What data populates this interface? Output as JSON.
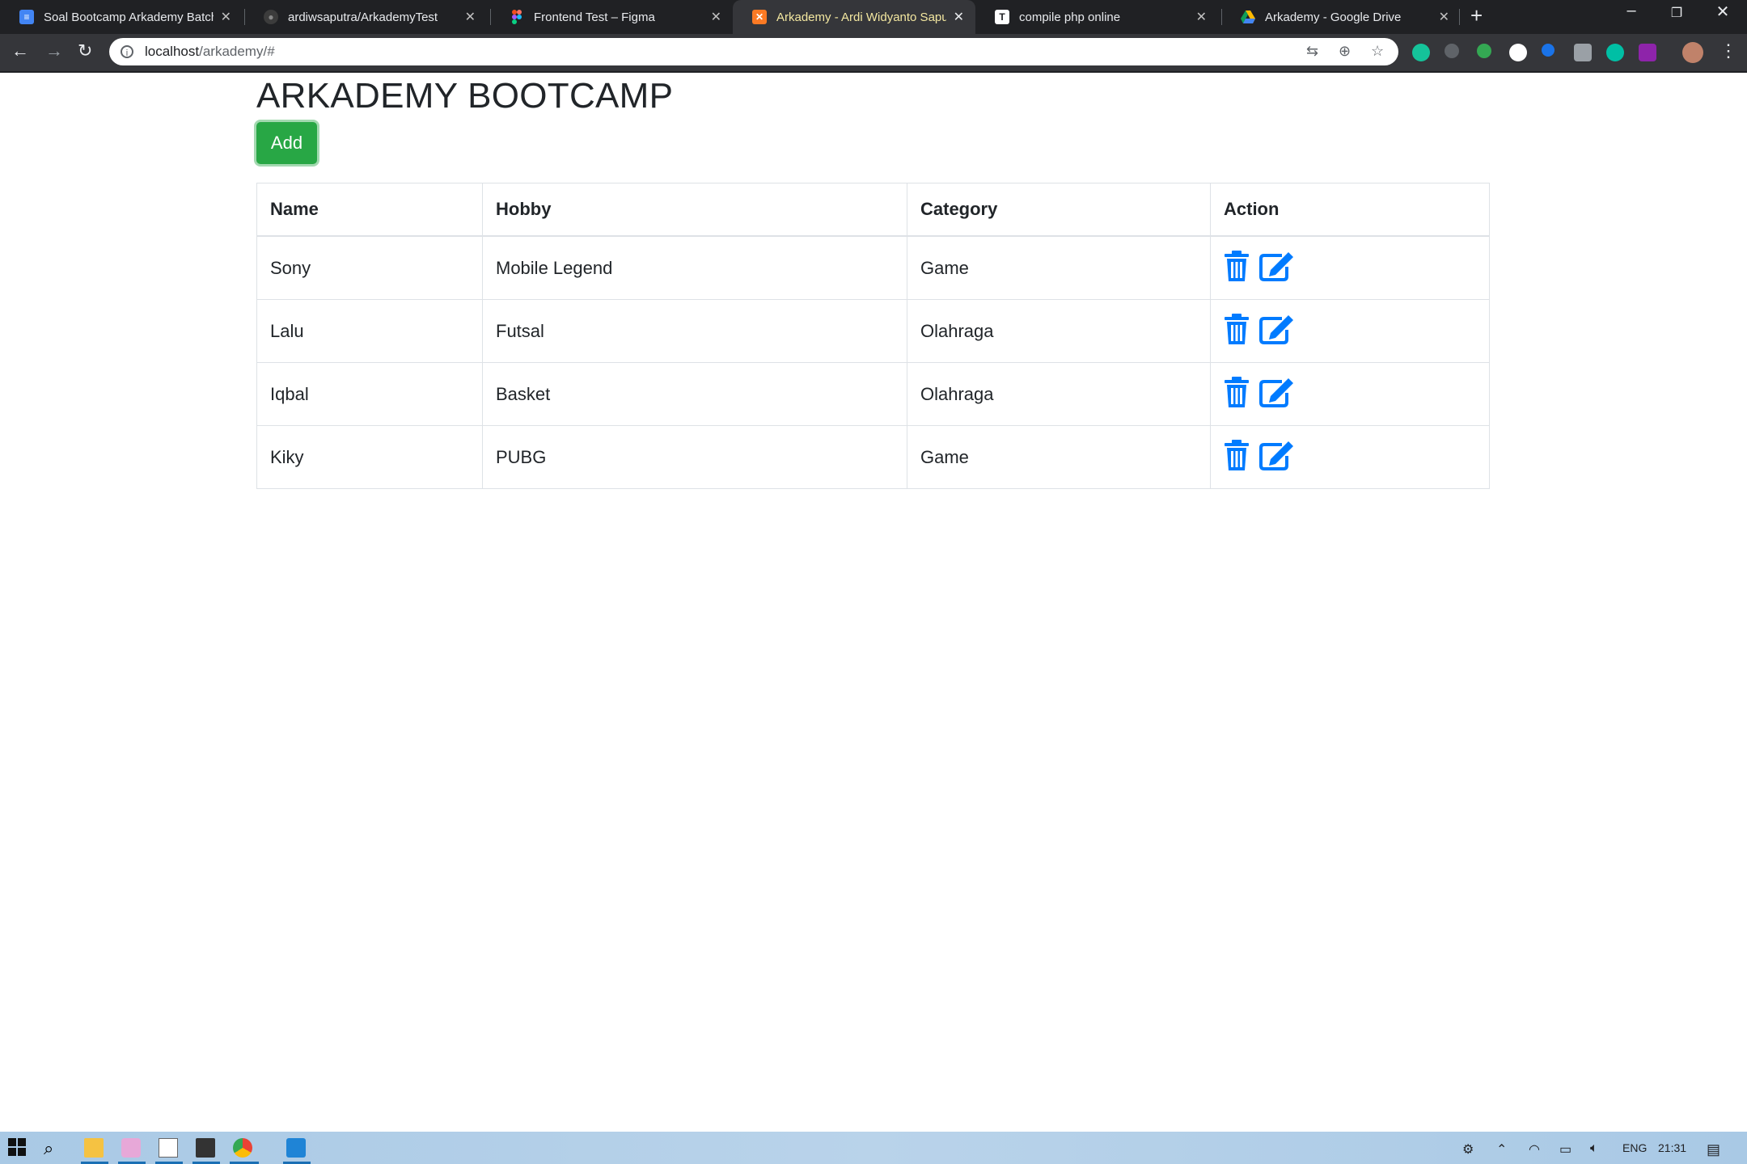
{
  "browser": {
    "tabs": [
      {
        "title": "Soal Bootcamp Arkademy Batch",
        "icon": "docs-icon",
        "color": "#4285f4"
      },
      {
        "title": "ardiwsaputra/ArkademyTest",
        "icon": "github-icon",
        "color": "#24292e"
      },
      {
        "title": "Frontend Test – Figma",
        "icon": "figma-icon",
        "color": "#f24e1e"
      },
      {
        "title": "Arkademy - Ardi Widyanto Saputra",
        "icon": "xampp-icon",
        "color": "#fb7a24"
      },
      {
        "title": "compile php online",
        "icon": "tio-icon",
        "color": "#ffffff"
      },
      {
        "title": "Arkademy - Google Drive",
        "icon": "drive-icon",
        "color": "#0f9d58"
      }
    ],
    "url_host": "localhost",
    "url_path": "/arkademy/#"
  },
  "page": {
    "title": "ARKADEMY BOOTCAMP",
    "add_label": "Add"
  },
  "table": {
    "headers": [
      "Name",
      "Hobby",
      "Category",
      "Action"
    ],
    "rows": [
      {
        "name": "Sony",
        "hobby": "Mobile Legend",
        "category": "Game"
      },
      {
        "name": "Lalu",
        "hobby": "Futsal",
        "category": "Olahraga"
      },
      {
        "name": "Iqbal",
        "hobby": "Basket",
        "category": "Olahraga"
      },
      {
        "name": "Kiky",
        "hobby": "PUBG",
        "category": "Game"
      }
    ]
  },
  "colors": {
    "add_button": "#28a745",
    "action_icons": "#007bff"
  },
  "taskbar": {
    "language": "ENG",
    "time": "21:31"
  }
}
